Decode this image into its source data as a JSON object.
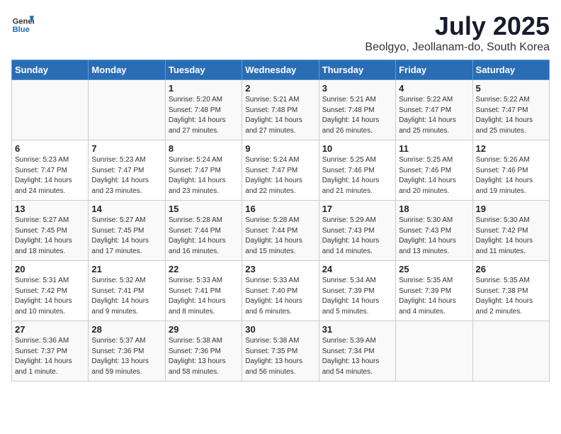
{
  "header": {
    "logo_general": "General",
    "logo_blue": "Blue",
    "title": "July 2025",
    "subtitle": "Beolgyo, Jeollanam-do, South Korea"
  },
  "days_of_week": [
    "Sunday",
    "Monday",
    "Tuesday",
    "Wednesday",
    "Thursday",
    "Friday",
    "Saturday"
  ],
  "weeks": [
    [
      {
        "day": "",
        "lines": []
      },
      {
        "day": "",
        "lines": []
      },
      {
        "day": "1",
        "lines": [
          "Sunrise: 5:20 AM",
          "Sunset: 7:48 PM",
          "Daylight: 14 hours",
          "and 27 minutes."
        ]
      },
      {
        "day": "2",
        "lines": [
          "Sunrise: 5:21 AM",
          "Sunset: 7:48 PM",
          "Daylight: 14 hours",
          "and 27 minutes."
        ]
      },
      {
        "day": "3",
        "lines": [
          "Sunrise: 5:21 AM",
          "Sunset: 7:48 PM",
          "Daylight: 14 hours",
          "and 26 minutes."
        ]
      },
      {
        "day": "4",
        "lines": [
          "Sunrise: 5:22 AM",
          "Sunset: 7:47 PM",
          "Daylight: 14 hours",
          "and 25 minutes."
        ]
      },
      {
        "day": "5",
        "lines": [
          "Sunrise: 5:22 AM",
          "Sunset: 7:47 PM",
          "Daylight: 14 hours",
          "and 25 minutes."
        ]
      }
    ],
    [
      {
        "day": "6",
        "lines": [
          "Sunrise: 5:23 AM",
          "Sunset: 7:47 PM",
          "Daylight: 14 hours",
          "and 24 minutes."
        ]
      },
      {
        "day": "7",
        "lines": [
          "Sunrise: 5:23 AM",
          "Sunset: 7:47 PM",
          "Daylight: 14 hours",
          "and 23 minutes."
        ]
      },
      {
        "day": "8",
        "lines": [
          "Sunrise: 5:24 AM",
          "Sunset: 7:47 PM",
          "Daylight: 14 hours",
          "and 23 minutes."
        ]
      },
      {
        "day": "9",
        "lines": [
          "Sunrise: 5:24 AM",
          "Sunset: 7:47 PM",
          "Daylight: 14 hours",
          "and 22 minutes."
        ]
      },
      {
        "day": "10",
        "lines": [
          "Sunrise: 5:25 AM",
          "Sunset: 7:46 PM",
          "Daylight: 14 hours",
          "and 21 minutes."
        ]
      },
      {
        "day": "11",
        "lines": [
          "Sunrise: 5:25 AM",
          "Sunset: 7:46 PM",
          "Daylight: 14 hours",
          "and 20 minutes."
        ]
      },
      {
        "day": "12",
        "lines": [
          "Sunrise: 5:26 AM",
          "Sunset: 7:46 PM",
          "Daylight: 14 hours",
          "and 19 minutes."
        ]
      }
    ],
    [
      {
        "day": "13",
        "lines": [
          "Sunrise: 5:27 AM",
          "Sunset: 7:45 PM",
          "Daylight: 14 hours",
          "and 18 minutes."
        ]
      },
      {
        "day": "14",
        "lines": [
          "Sunrise: 5:27 AM",
          "Sunset: 7:45 PM",
          "Daylight: 14 hours",
          "and 17 minutes."
        ]
      },
      {
        "day": "15",
        "lines": [
          "Sunrise: 5:28 AM",
          "Sunset: 7:44 PM",
          "Daylight: 14 hours",
          "and 16 minutes."
        ]
      },
      {
        "day": "16",
        "lines": [
          "Sunrise: 5:28 AM",
          "Sunset: 7:44 PM",
          "Daylight: 14 hours",
          "and 15 minutes."
        ]
      },
      {
        "day": "17",
        "lines": [
          "Sunrise: 5:29 AM",
          "Sunset: 7:43 PM",
          "Daylight: 14 hours",
          "and 14 minutes."
        ]
      },
      {
        "day": "18",
        "lines": [
          "Sunrise: 5:30 AM",
          "Sunset: 7:43 PM",
          "Daylight: 14 hours",
          "and 13 minutes."
        ]
      },
      {
        "day": "19",
        "lines": [
          "Sunrise: 5:30 AM",
          "Sunset: 7:42 PM",
          "Daylight: 14 hours",
          "and 11 minutes."
        ]
      }
    ],
    [
      {
        "day": "20",
        "lines": [
          "Sunrise: 5:31 AM",
          "Sunset: 7:42 PM",
          "Daylight: 14 hours",
          "and 10 minutes."
        ]
      },
      {
        "day": "21",
        "lines": [
          "Sunrise: 5:32 AM",
          "Sunset: 7:41 PM",
          "Daylight: 14 hours",
          "and 9 minutes."
        ]
      },
      {
        "day": "22",
        "lines": [
          "Sunrise: 5:33 AM",
          "Sunset: 7:41 PM",
          "Daylight: 14 hours",
          "and 8 minutes."
        ]
      },
      {
        "day": "23",
        "lines": [
          "Sunrise: 5:33 AM",
          "Sunset: 7:40 PM",
          "Daylight: 14 hours",
          "and 6 minutes."
        ]
      },
      {
        "day": "24",
        "lines": [
          "Sunrise: 5:34 AM",
          "Sunset: 7:39 PM",
          "Daylight: 14 hours",
          "and 5 minutes."
        ]
      },
      {
        "day": "25",
        "lines": [
          "Sunrise: 5:35 AM",
          "Sunset: 7:39 PM",
          "Daylight: 14 hours",
          "and 4 minutes."
        ]
      },
      {
        "day": "26",
        "lines": [
          "Sunrise: 5:35 AM",
          "Sunset: 7:38 PM",
          "Daylight: 14 hours",
          "and 2 minutes."
        ]
      }
    ],
    [
      {
        "day": "27",
        "lines": [
          "Sunrise: 5:36 AM",
          "Sunset: 7:37 PM",
          "Daylight: 14 hours",
          "and 1 minute."
        ]
      },
      {
        "day": "28",
        "lines": [
          "Sunrise: 5:37 AM",
          "Sunset: 7:36 PM",
          "Daylight: 13 hours",
          "and 59 minutes."
        ]
      },
      {
        "day": "29",
        "lines": [
          "Sunrise: 5:38 AM",
          "Sunset: 7:36 PM",
          "Daylight: 13 hours",
          "and 58 minutes."
        ]
      },
      {
        "day": "30",
        "lines": [
          "Sunrise: 5:38 AM",
          "Sunset: 7:35 PM",
          "Daylight: 13 hours",
          "and 56 minutes."
        ]
      },
      {
        "day": "31",
        "lines": [
          "Sunrise: 5:39 AM",
          "Sunset: 7:34 PM",
          "Daylight: 13 hours",
          "and 54 minutes."
        ]
      },
      {
        "day": "",
        "lines": []
      },
      {
        "day": "",
        "lines": []
      }
    ]
  ]
}
